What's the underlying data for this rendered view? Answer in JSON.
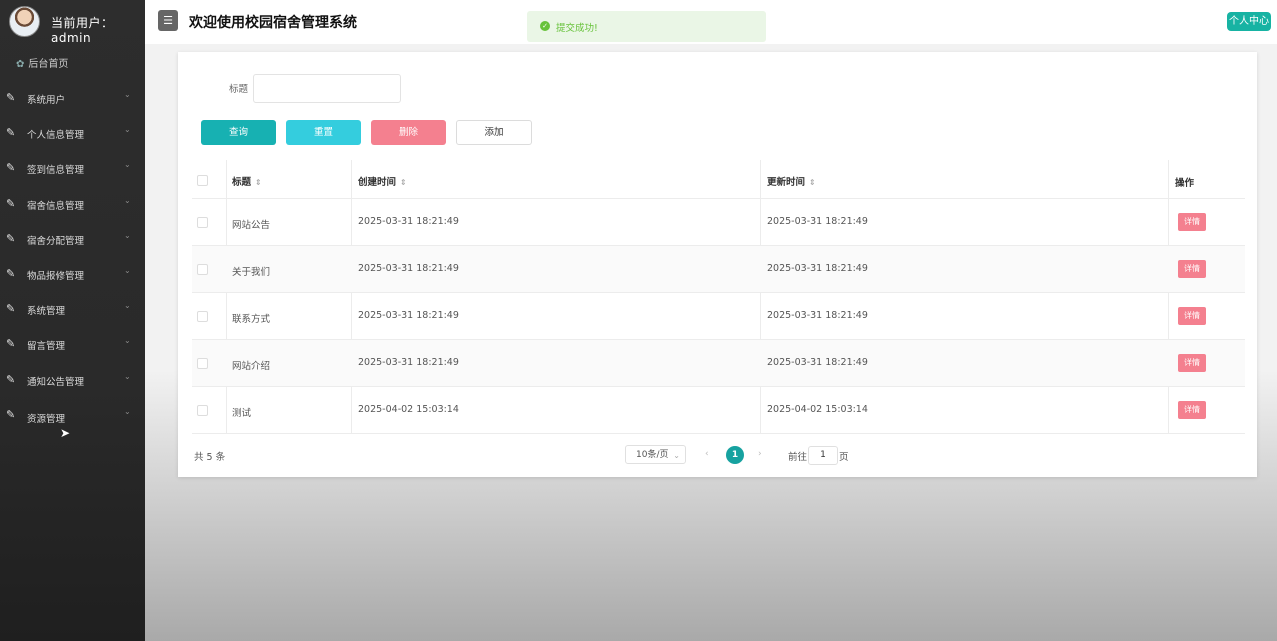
{
  "sidebar": {
    "user_label": "当前用户：  admin",
    "home": "后台首页",
    "items": [
      {
        "label": "系统用户"
      },
      {
        "label": "个人信息管理"
      },
      {
        "label": "签到信息管理"
      },
      {
        "label": "宿舍信息管理"
      },
      {
        "label": "宿舍分配管理"
      },
      {
        "label": "物品报修管理"
      },
      {
        "label": "系统管理"
      },
      {
        "label": "留言管理"
      },
      {
        "label": "通知公告管理"
      },
      {
        "label": "资源管理"
      }
    ]
  },
  "header": {
    "title": "欢迎使用校园宿舍管理系统",
    "profile": "个人中心",
    "menu_icon": "☰"
  },
  "toast": {
    "message": "提交成功!"
  },
  "search": {
    "label": "标题",
    "value": ""
  },
  "toolbar": {
    "query": "查询",
    "reset": "重置",
    "delete": "删除",
    "add": "添加"
  },
  "table": {
    "columns": [
      "标题",
      "创建时间",
      "更新时间",
      "操作"
    ],
    "rows": [
      {
        "title": "网站公告",
        "created": "2025-03-31 18:21:49",
        "updated": "2025-03-31 18:21:49",
        "action": "详情"
      },
      {
        "title": "关于我们",
        "created": "2025-03-31 18:21:49",
        "updated": "2025-03-31 18:21:49",
        "action": "详情"
      },
      {
        "title": "联系方式",
        "created": "2025-03-31 18:21:49",
        "updated": "2025-03-31 18:21:49",
        "action": "详情"
      },
      {
        "title": "网站介绍",
        "created": "2025-03-31 18:21:49",
        "updated": "2025-03-31 18:21:49",
        "action": "详情"
      },
      {
        "title": "测试",
        "created": "2025-04-02 15:03:14",
        "updated": "2025-04-02 15:03:14",
        "action": "详情"
      }
    ]
  },
  "pagination": {
    "total": "共 5 条",
    "page_size": "10条/页",
    "current_page": "1",
    "goto_label": "前往",
    "goto_value": "1",
    "goto_suffix": "页"
  },
  "colors": {
    "sidebar_bg": "#2a2a2a",
    "accent": "#17b1b2",
    "danger": "#f4808f",
    "success": "#67c23a"
  }
}
